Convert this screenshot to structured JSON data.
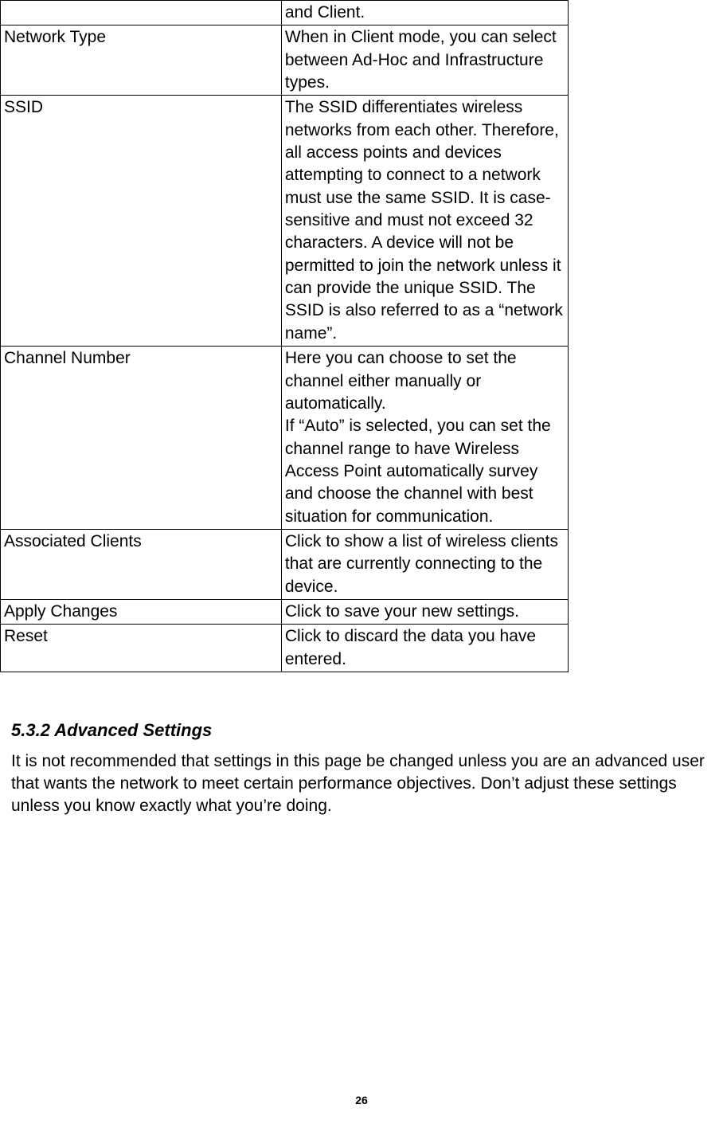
{
  "table": {
    "rows": [
      {
        "label": "",
        "desc": "and Client."
      },
      {
        "label": "Network Type",
        "desc": "When in Client mode, you can select between Ad-Hoc and Infrastructure types."
      },
      {
        "label": "SSID",
        "desc": "The SSID differentiates wireless networks from each other. Therefore, all access points and devices attempting to connect to a network must use the same SSID. It is case-sensitive and must not exceed 32 characters. A device will not be permitted to join the network unless it can provide the unique SSID. The SSID is also referred to as a “network name”."
      },
      {
        "label": "Channel Number",
        "desc": "Here you can choose to set the channel either manually or automatically.\nIf “Auto” is selected, you can set the channel range to have Wireless Access Point automatically survey and choose the channel with best situation for communication."
      },
      {
        "label": "Associated Clients",
        "desc": "Click to show a list of wireless clients that are currently connecting to the device."
      },
      {
        "label": "Apply Changes",
        "desc": "Click to save your new settings."
      },
      {
        "label": "Reset",
        "desc": "Click to discard the data you have entered."
      }
    ]
  },
  "section": {
    "heading": "5.3.2 Advanced Settings",
    "paragraph": "It is not recommended that settings in this page be changed unless you are an advanced user that wants the network to meet certain performance objectives. Don’t adjust these settings unless you know exactly what you’re doing."
  },
  "page_number": "26"
}
